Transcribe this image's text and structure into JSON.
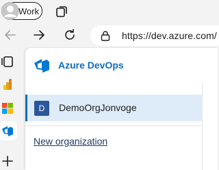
{
  "profile": {
    "label": "Work",
    "icon": "person-avatar-icon"
  },
  "tabs": {
    "actions_icon": "tab-actions-icon"
  },
  "toolbar": {
    "back_icon": "back-arrow-icon",
    "forward_icon": "forward-arrow-icon",
    "refresh_icon": "refresh-icon",
    "url": "https://dev.azure.com/"
  },
  "sidebar": {
    "items": [
      {
        "name": "tab-switcher",
        "icon": "tab-stack-icon"
      },
      {
        "name": "power-bi",
        "icon": "power-bi-icon"
      },
      {
        "name": "microsoft-store",
        "icon": "microsoft-logo-icon"
      },
      {
        "name": "azure-devops",
        "icon": "azure-devops-icon",
        "active": true
      },
      {
        "name": "add",
        "icon": "plus-icon"
      }
    ]
  },
  "panel": {
    "brand_title": "Azure DevOps",
    "organization": {
      "badge": "D",
      "name": "DemoOrgJonvoge",
      "selected": true
    },
    "new_org_link": "New organization"
  },
  "colors": {
    "accent": "#0f6cbd",
    "selected_row_bg": "#deecf9",
    "org_badge": "#2b579a",
    "chrome_bg": "#f3f3f3"
  }
}
